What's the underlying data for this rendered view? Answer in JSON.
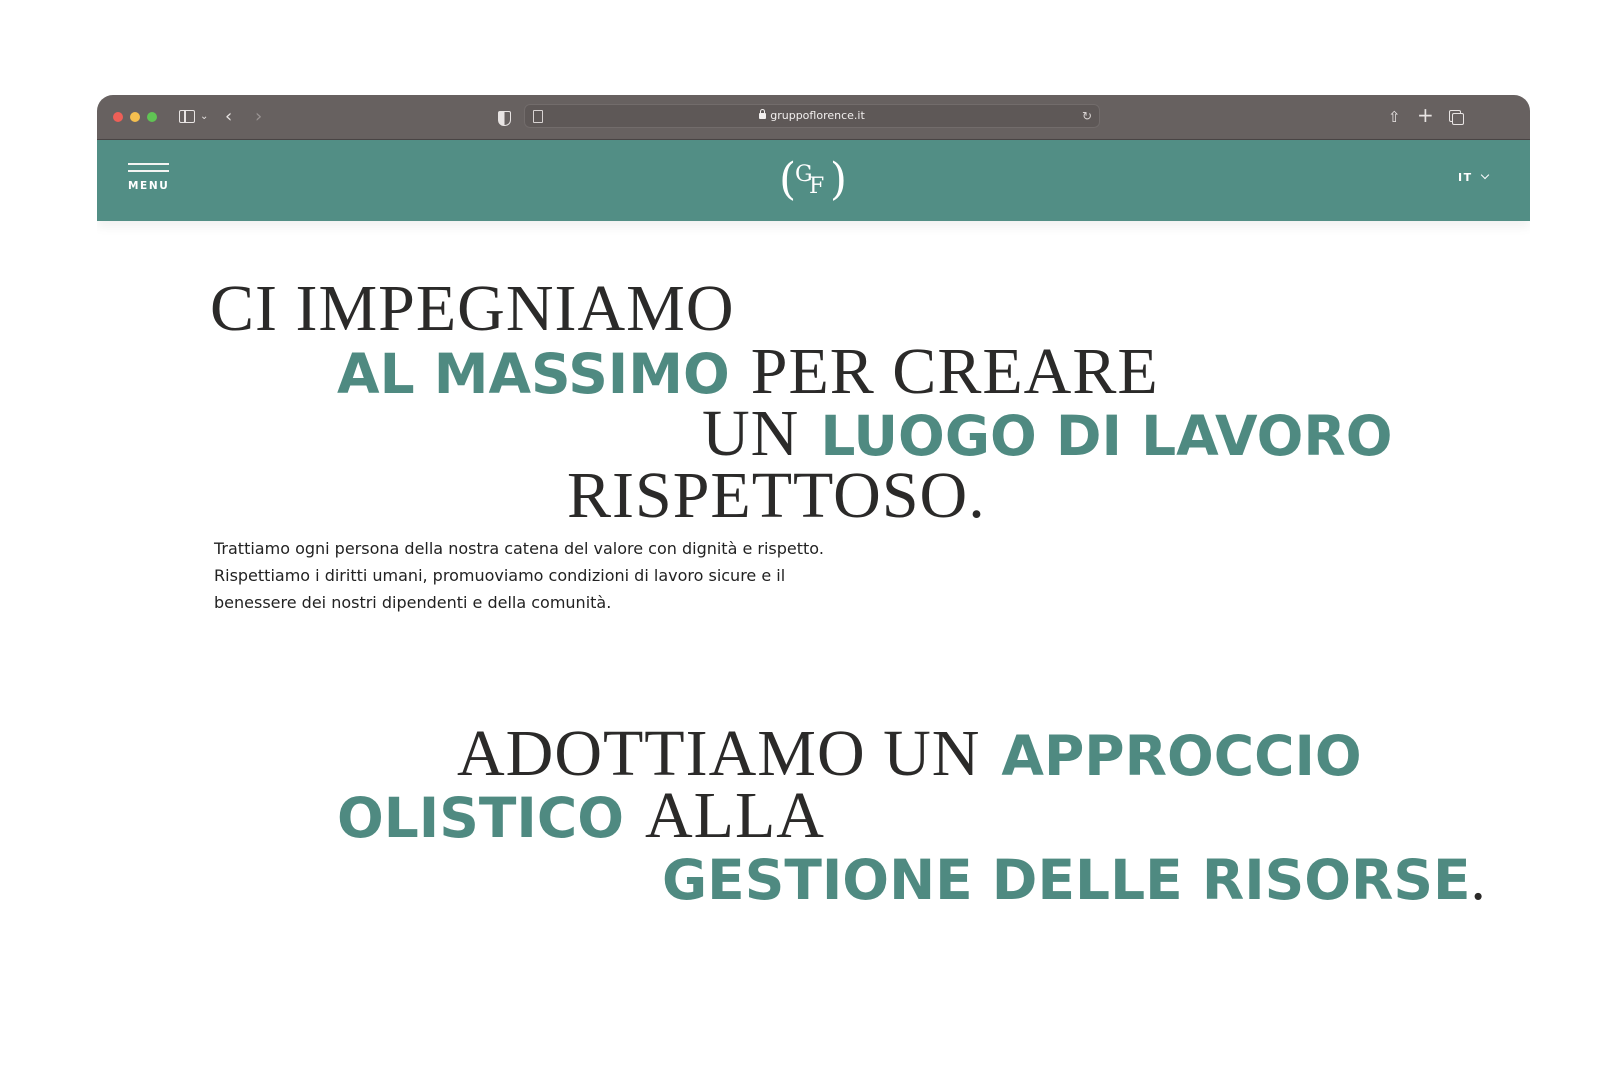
{
  "browser": {
    "url": "gruppoflorence.it"
  },
  "header": {
    "menu_label": "MENU",
    "logo_text": "GF",
    "language": "IT",
    "background_color": "#528e85"
  },
  "hero": {
    "line1_serif": "CI IMPEGNIAMO",
    "line2_accent": "AL MASSIMO",
    "line2_serif": "PER CREARE",
    "line3_serif": "UN",
    "line3_accent": "LUOGO DI LAVORO",
    "line4_serif": "RISPETTOSO.",
    "paragraph": "Trattiamo ogni persona della nostra catena del valore con dignità e rispetto. Rispettiamo i diritti umani, promuoviamo condizioni di lavoro sicure e il benessere dei nostri dipendenti e della comunità."
  },
  "section2": {
    "line1_serif": "ADOTTIAMO UN",
    "line1_accent": "APPROCCIO",
    "line2_accent": "OLISTICO",
    "line2_serif": "ALLA",
    "line3_accent": "GESTIONE DELLE RISORSE",
    "line3_period": "."
  },
  "colors": {
    "accent": "#4f8a81",
    "text": "#2b2a29",
    "toolbar": "#676160"
  },
  "icons": {
    "traffic_lights": [
      "close-dot",
      "minimize-dot",
      "zoom-dot"
    ],
    "toolbar": [
      "sidebar-icon",
      "chevron-down-icon",
      "back-icon",
      "forward-icon",
      "shield-icon",
      "page-icon",
      "lock-icon",
      "reload-icon",
      "share-icon",
      "plus-icon",
      "tabs-icon"
    ],
    "site": [
      "hamburger-icon",
      "chevron-down-icon"
    ]
  }
}
